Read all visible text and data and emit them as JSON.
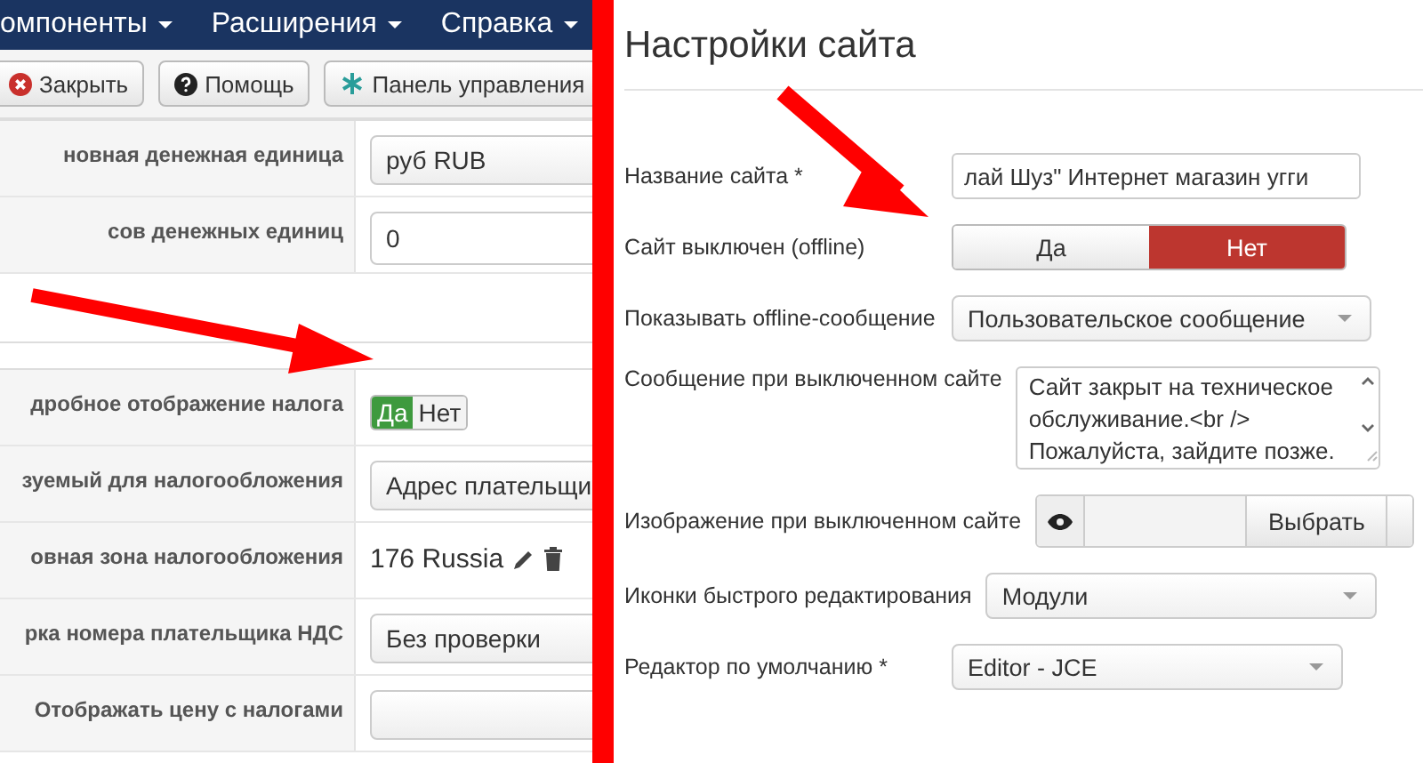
{
  "left_panel": {
    "menu": [
      {
        "label": "омпоненты"
      },
      {
        "label": "Расширения"
      },
      {
        "label": "Справка"
      }
    ],
    "toolbar": [
      {
        "label": "Закрыть",
        "kind": "close"
      },
      {
        "label": "Помощь",
        "kind": "help"
      },
      {
        "label": "Панель управления",
        "kind": "dashboard"
      }
    ],
    "sections": [
      {
        "rows": [
          {
            "kind": "select",
            "label": "новная денежная единица",
            "value": "руб RUB"
          },
          {
            "kind": "input",
            "label": "сов денежных единиц",
            "value": "0"
          }
        ]
      },
      {
        "rows": [
          {
            "kind": "toggle",
            "label": "дробное отображение налога",
            "options": [
              {
                "label": "Да",
                "selected": true
              },
              {
                "label": "Нет",
                "selected": false
              }
            ]
          },
          {
            "kind": "select",
            "label": "зуемый для налогообложения",
            "value": "Адрес плательщи"
          },
          {
            "kind": "zone",
            "label": "овная зона налогообложения",
            "value": "176 Russia"
          },
          {
            "kind": "select",
            "label": "рка номера плательщика НДС",
            "value": "Без проверки"
          },
          {
            "kind": "select",
            "label": "Отображать цену с налогами"
          }
        ]
      }
    ]
  },
  "right_panel": {
    "title": "Настройки сайта",
    "fields": [
      {
        "kind": "input",
        "label": "Название сайта *",
        "value": "лай Шуз\" Интернет магазин угги"
      },
      {
        "kind": "toggle",
        "label": "Сайт выключен (offline)",
        "options": [
          {
            "label": "Да",
            "selected": false
          },
          {
            "label": "Нет",
            "selected": true
          }
        ]
      },
      {
        "kind": "select",
        "label": "Показывать offline-сообщение",
        "value": "Пользовательское сообщение"
      },
      {
        "kind": "textarea",
        "label": "Сообщение при выключенном сайте",
        "value": "Сайт закрыт на техническое обслуживание.<br /> Пожалуйста, зайдите позже."
      },
      {
        "kind": "media",
        "label": "Изображение при выключенном сайте",
        "button": "Выбрать"
      },
      {
        "kind": "select",
        "label": "Иконки быстрого редактирования",
        "value": "Модули"
      },
      {
        "kind": "select",
        "label": "Редактор по умолчанию *",
        "value": "Editor - JCE"
      }
    ]
  }
}
